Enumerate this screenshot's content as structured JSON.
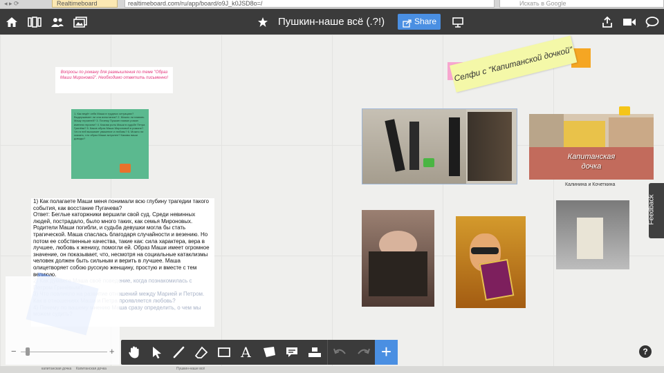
{
  "browser": {
    "tab_label": "Realtimeboard",
    "url": "realtimeboard.com/ru/app/board/o9J_k0JSD8o=/",
    "search_placeholder": "Искать в Google"
  },
  "header": {
    "title": "Пушкин-наше всё (.?!)",
    "share_label": "Share",
    "icons": [
      "home-icon",
      "pages-icon",
      "users-icon",
      "images-icon",
      "star-icon",
      "share-icon",
      "present-icon",
      "upload-icon",
      "video-icon",
      "chat-icon"
    ]
  },
  "board": {
    "pink_note_text": "Вопросы по роману для размышления по теме \"Образ Маши Мироновой\". Необходимо ответить письменно!",
    "green_note_text": "1. Как ведёт себя Маша в трудных ситуациях? Выдерживает ли она испытания? 2. Можно ли назвать Машу героиней? 3. Почему Пушкин назвал роман именем героини? 4. Какова роль Маши в судьбе Петра Гринёва? 5. Каков образ Маши Мироновой в романе? Что в ней вызывает уважение и любовь? 6. Можно ли сказать, что образ Маши актуален? Каковы ваши доводы?",
    "answer_text_1": "1) Как полагаете Маши меня понимали всю глубину трагедии такого события, как восстание Пугачева?",
    "answer_text_2": "Ответ: Беглые каторжники вершили свой суд. Среди невинных людей, пострадало, было много таких, как семья Мироновых. Родители Маши погибли, и судьба девушки могла бы стать трагической. Маша спаслась благодаря случайности и везению. Но потом ее собственные качества, такие как: сила характера, вера в лучшее, любовь к жениху, помогли ей. Образ Маши имеет огромное значение, он показывает, что, несмотря на социальные катаклизмы человек должен быть сильным и верить в лучшее. Маша олицетворяет собою русскую женщину, простую и вместе с тем великую.",
    "answer_text_faded_1": "2) Как думаете Маша своё поведение, когда познакомилась с Петром Гринёвым?",
    "answer_text_faded_2": "3) Что повлияло на развитие отношений между Марией и Петром. Как в отношениях Маши и Петра проявляется любовь?",
    "answer_text_faded_3": "4) Почему по вашему мнению Маша сразу определить, о чем мы можем судить?",
    "selfie_title": "Селфи с \"Капитанской дочкой\"",
    "collage_caption": "Калинина и Кочеткина",
    "collage_title_text": "Капитанская дочка"
  },
  "toolbar": {
    "tools": [
      "hand-icon",
      "select-icon",
      "pen-icon",
      "eraser-icon",
      "rectangle-icon",
      "text-icon",
      "sticker-icon",
      "comment-icon",
      "frame-icon",
      "undo-icon",
      "redo-icon"
    ],
    "add_label": "+"
  },
  "zoom": {
    "minus": "−",
    "plus": "+"
  },
  "feedback_label": "Feedback",
  "help_label": "?",
  "colors": {
    "topbar": "#3b3b3b",
    "accent": "#4a8fe2",
    "sticky_pink": "#f7a6cf",
    "sticky_orange": "#f5a623",
    "note_green": "#5bb98f",
    "selfie_yellow": "#f4f8a8"
  },
  "bottom_strip": {
    "left_text": "капитанская дочка",
    "mid_text": "Капитанская дочка",
    "right_text": "Пушкин-наше всё"
  }
}
